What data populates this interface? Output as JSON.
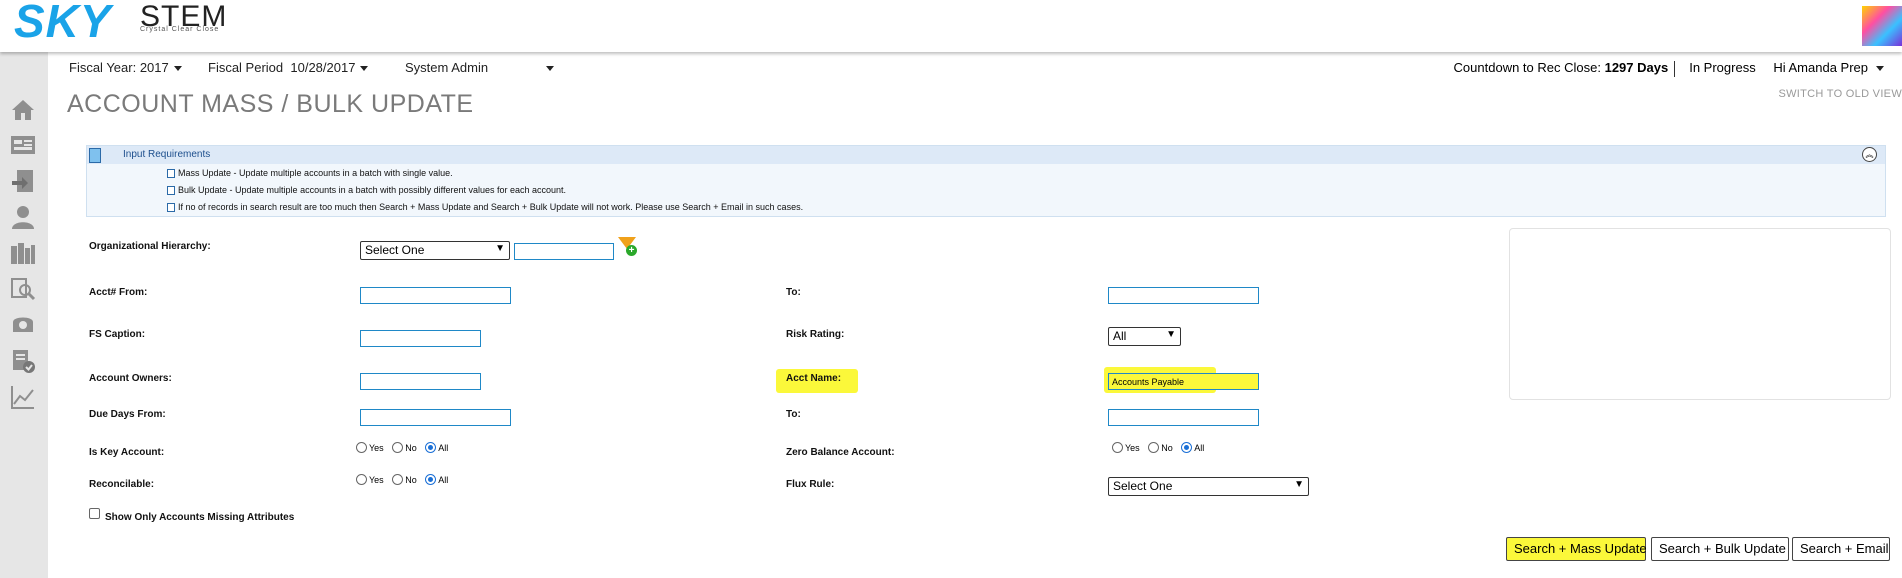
{
  "brand": {
    "logo_left": "SKY",
    "logo_right": "STEM",
    "tagline": "Crystal Clear Close",
    "accent": "#1aa3e8"
  },
  "nav": {
    "fiscal_year": "Fiscal Year: 2017",
    "fiscal_period_label": "Fiscal Period",
    "fiscal_period_value": "10/28/2017",
    "role": "System Admin",
    "countdown_label": "Countdown to Rec Close:",
    "countdown_value": "1297 Days",
    "status": "In Progress",
    "greeting": "Hi Amanda Prep"
  },
  "sidebar_icons": [
    "home-icon",
    "dashboard-icon",
    "import-icon",
    "user-icon",
    "library-icon",
    "search-report-icon",
    "support-icon",
    "certify-icon",
    "chart-icon"
  ],
  "page": {
    "title": "ACCOUNT MASS / BULK UPDATE",
    "switch_view": "SWITCH TO OLD VIEW"
  },
  "requirements": {
    "title": "Input Requirements",
    "lines": [
      "Mass Update - Update multiple accounts in a batch with single value.",
      "Bulk Update - Update multiple accounts in a batch with possibly different values for each account.",
      "If no of records in search result are too much then Search + Mass Update and Search + Bulk Update will not work. Please use Search + Email in such cases."
    ]
  },
  "form": {
    "org_hierarchy_label": "Organizational Hierarchy:",
    "org_hierarchy_value": "Select One",
    "org_hierarchy_text": "",
    "acct_from_label": "Acct# From:",
    "acct_from_value": "",
    "acct_to_label": "To:",
    "acct_to_value": "",
    "fs_caption_label": "FS Caption:",
    "fs_caption_value": "",
    "risk_rating_label": "Risk Rating:",
    "risk_rating_value": "All",
    "account_owners_label": "Account Owners:",
    "account_owners_value": "",
    "acct_name_label": "Acct Name:",
    "acct_name_value": "Accounts Payable",
    "due_days_from_label": "Due Days From:",
    "due_days_from_value": "",
    "due_days_to_label": "To:",
    "due_days_to_value": "",
    "is_key_account_label": "Is Key Account:",
    "zero_balance_label": "Zero Balance Account:",
    "reconcilable_label": "Reconcilable:",
    "flux_rule_label": "Flux Rule:",
    "flux_rule_value": "Select One",
    "radio_yes": "Yes",
    "radio_no": "No",
    "radio_all": "All",
    "is_key_account_selected": "All",
    "zero_balance_selected": "All",
    "reconcilable_selected": "All",
    "missing_attributes_label": "Show Only Accounts Missing Attributes",
    "missing_attributes_checked": false
  },
  "buttons": {
    "mass_update": "Search + Mass Update",
    "bulk_update": "Search + Bulk Update",
    "email": "Search + Email"
  },
  "highlight_color": "#fbf83a"
}
